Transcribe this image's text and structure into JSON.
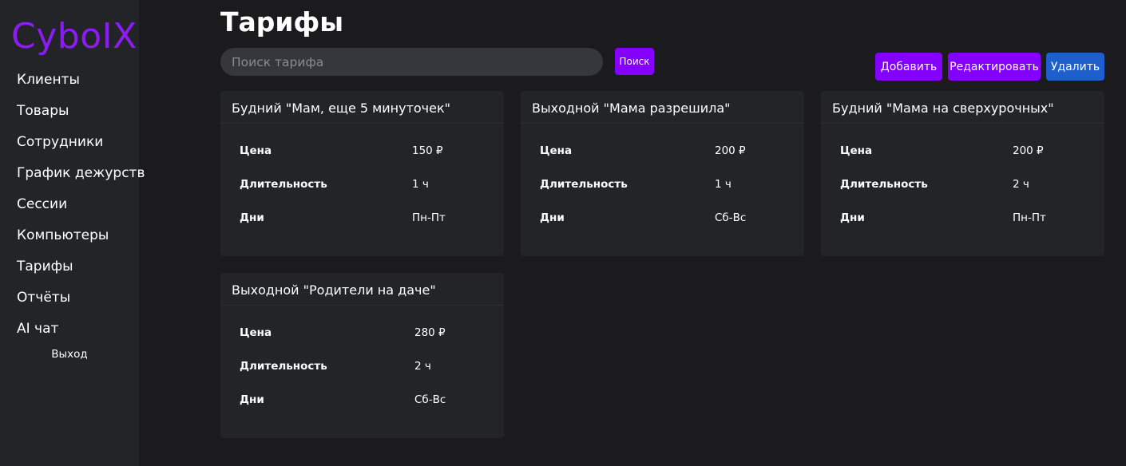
{
  "sidebar": {
    "logo": "CyboIX",
    "items": [
      {
        "label": "Клиенты"
      },
      {
        "label": "Товары"
      },
      {
        "label": "Сотрудники"
      },
      {
        "label": "График дежурств"
      },
      {
        "label": "Сессии"
      },
      {
        "label": "Компьютеры"
      },
      {
        "label": "Тарифы"
      },
      {
        "label": "Отчёты"
      },
      {
        "label": "AI чат"
      }
    ],
    "logout": "Выход"
  },
  "main": {
    "title": "Тарифы",
    "search": {
      "placeholder": "Поиск тарифа",
      "value": "",
      "button": "Поиск"
    },
    "actions": {
      "add": "Добавить",
      "edit": "Редактировать",
      "delete": "Удалить"
    },
    "colors": {
      "accent": "#8400ff",
      "delete": "#1e5fcd",
      "logo": "#8b1cf2",
      "background": "#1b1b1d",
      "card": "#222428"
    },
    "labels": {
      "price": "Цена",
      "duration": "Длительность",
      "days": "Дни"
    },
    "tariffs": [
      {
        "name": "Будний \"Мам, еще 5 минуточек\"",
        "price": "150 ₽",
        "duration": "1 ч",
        "days": "Пн-Пт"
      },
      {
        "name": "Выходной \"Мама разрешила\"",
        "price": "200 ₽",
        "duration": "1 ч",
        "days": "Сб-Вс"
      },
      {
        "name": "Будний \"Мама на сверхурочных\"",
        "price": "200 ₽",
        "duration": "2 ч",
        "days": "Пн-Пт"
      },
      {
        "name": "Выходной \"Родители на даче\"",
        "price": "280 ₽",
        "duration": "2 ч",
        "days": "Сб-Вс"
      }
    ]
  }
}
